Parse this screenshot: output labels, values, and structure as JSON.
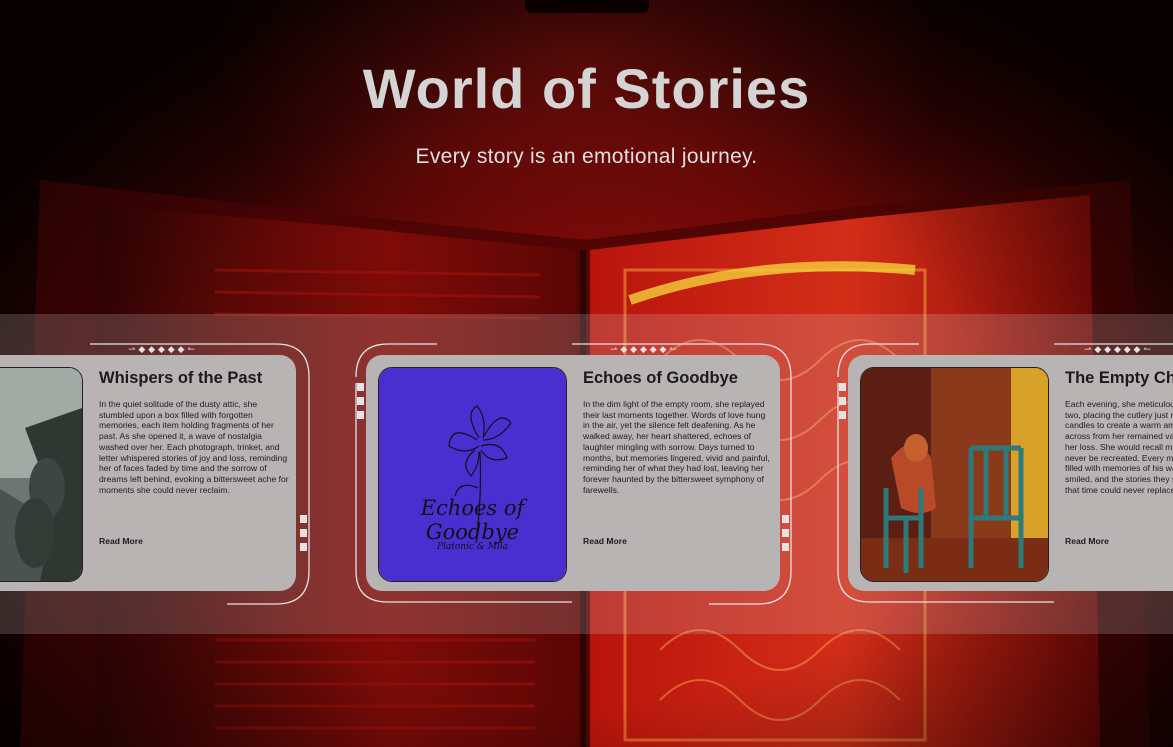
{
  "header": {
    "title": "World of Stories",
    "subtitle": "Every story is an emotional journey."
  },
  "cards": [
    {
      "title": "Whispers of the Past",
      "text": "In the quiet solitude of the dusty attic, she stumbled upon a box filled with forgotten memories, each item holding fragments of her past. As she opened it, a wave of nostalgia washed over her. Each photograph, trinket, and letter whispered stories of joy and loss, reminding her of faces faded by time and the sorrow of dreams left behind, evoking a bittersweet ache for moments she could never reclaim.",
      "read_more": "Read More",
      "image": "misty-forest-figures-painting"
    },
    {
      "title": "Echoes of Goodbye",
      "text": "In the dim light of the empty room, she replayed their last moments together. Words of love hung in the air, yet the silence felt deafening. As he walked away, her heart shattered, echoes of laughter mingling with sorrow. Days turned to months, but memories lingered, vivid and painful, reminding her of what they had lost, leaving her forever haunted by the bittersweet symphony of farewells.",
      "read_more": "Read More",
      "image": "flower-line-art-cover",
      "cover_text": "Echoes of Goodbye",
      "cover_signature": "Platonic & Mila",
      "cover_color": "#4a2fd0"
    },
    {
      "title": "The Empty Chair",
      "text": "Each evening, she meticulously set the table for two, placing the cutlery just right and lighting candles to create a warm ambiance. Yet the chair across from her remained vacant, a reminder of her loss. She would recall moments that could never be recreated. Every meal felt incomplete, filled with memories of his warmth, the way he smiled, and the stories they shared, memories that time could never replace.",
      "read_more": "Read More",
      "image": "two-chairs-painting"
    }
  ],
  "colors": {
    "background": "#6f0806",
    "card": "#b8b4b4",
    "title": "#d4d4d4"
  }
}
